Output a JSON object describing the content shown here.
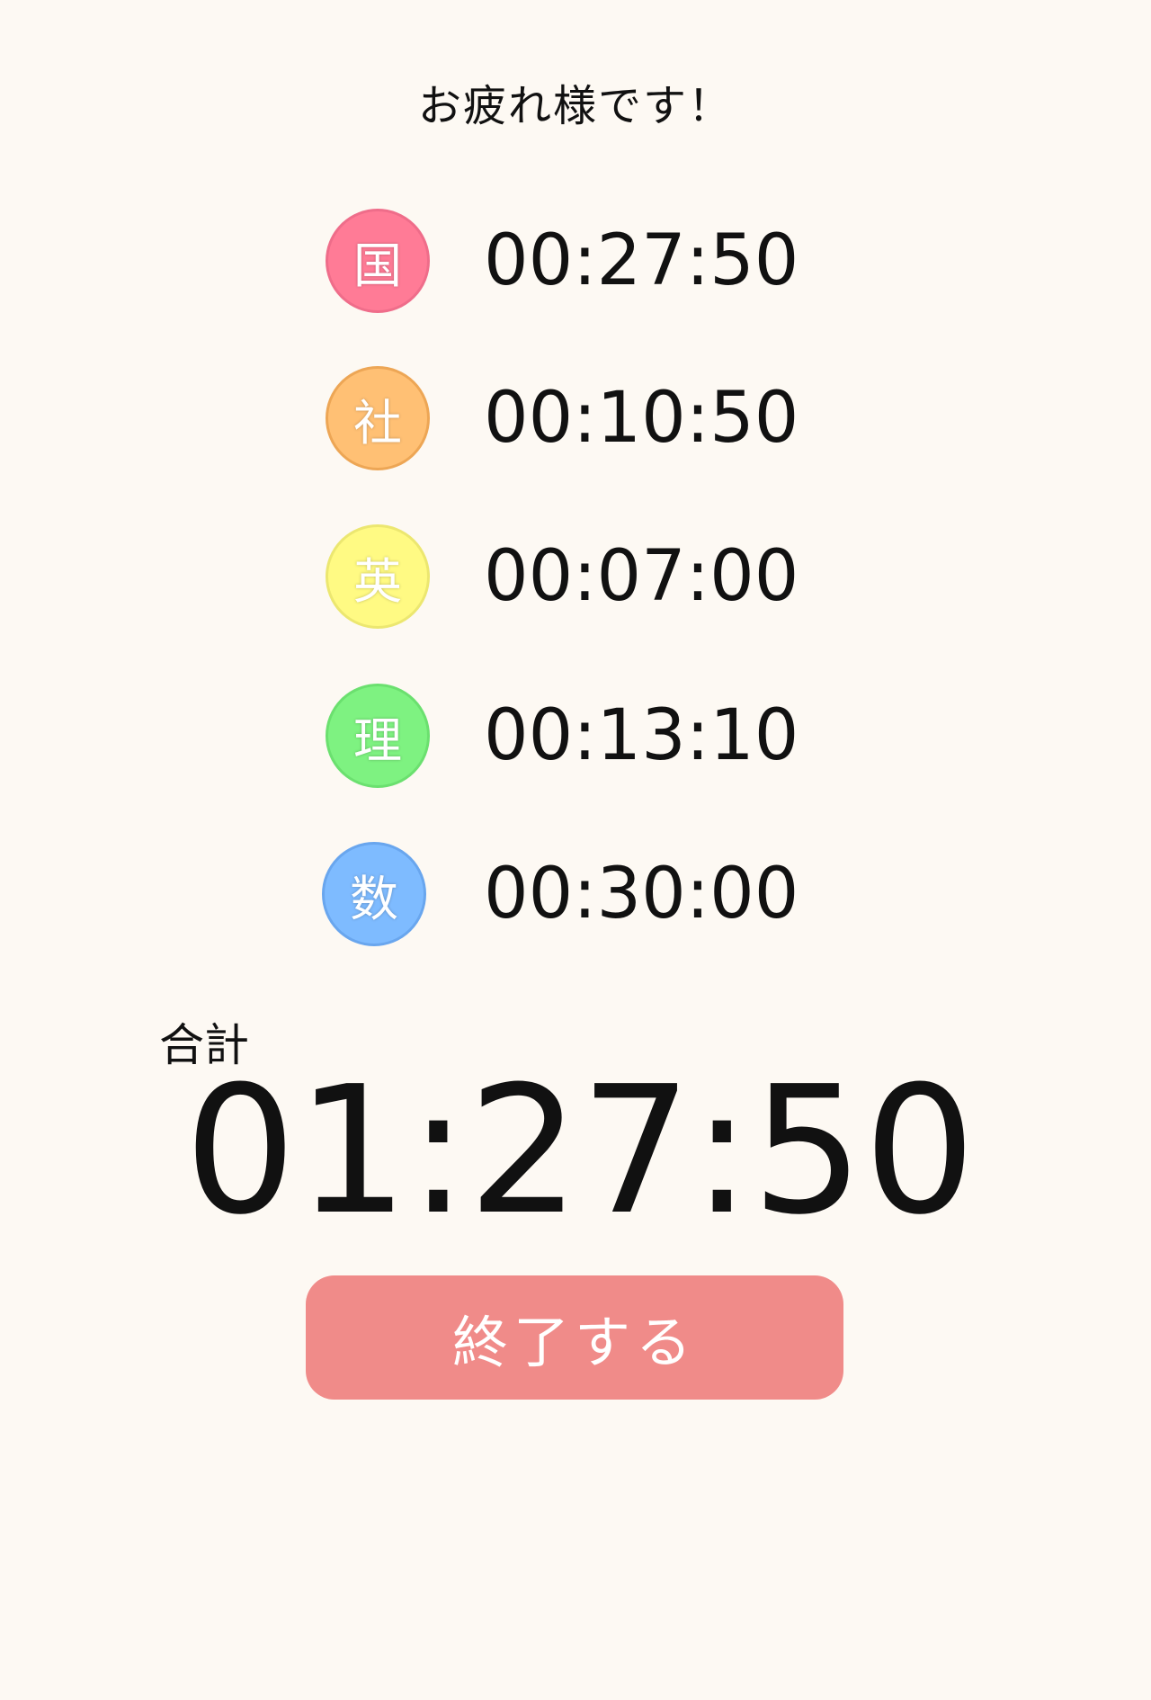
{
  "header": {
    "title": "お疲れ様です！"
  },
  "subjects": [
    {
      "label": "国",
      "time": "00:27:50",
      "color": "#ff7b96",
      "border": "#ef6d8a"
    },
    {
      "label": "社",
      "time": "00:10:50",
      "color": "#ffc074",
      "border": "#eda655"
    },
    {
      "label": "英",
      "time": "00:07:00",
      "color": "#fffa83",
      "border": "#ece770"
    },
    {
      "label": "理",
      "time": "00:13:10",
      "color": "#7ef281",
      "border": "#6be06f"
    },
    {
      "label": "数",
      "time": "00:30:00",
      "color": "#7ebbff",
      "border": "#69a6ee"
    }
  ],
  "total": {
    "label": "合計",
    "time": "01:27:50"
  },
  "finish_button": {
    "label": "終了する",
    "color": "#f08b89"
  }
}
